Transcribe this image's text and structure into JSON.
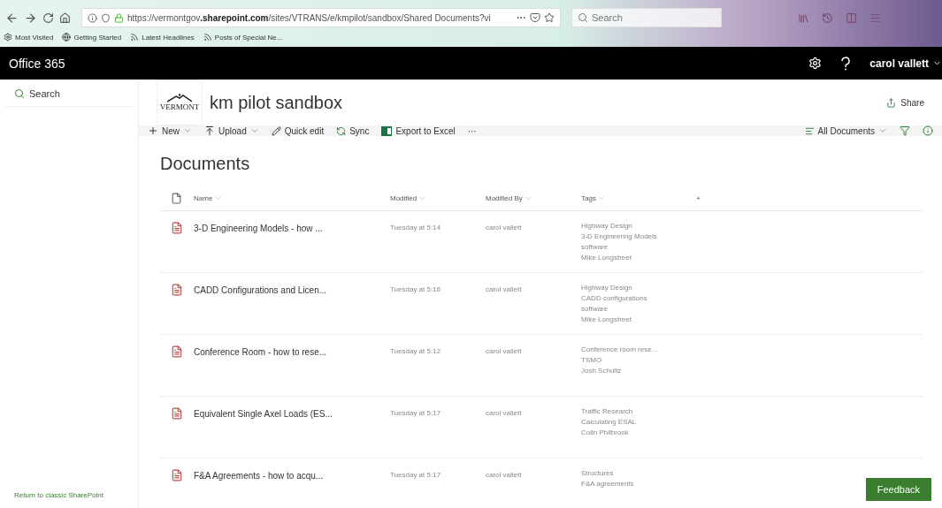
{
  "browser": {
    "url": "https://vermontgov**.sharepoint.com**/sites/VTRANS/e/kmpilot/sandbox/Shared Documents?vi",
    "search_placeholder": "Search",
    "bookmarks": [
      {
        "kind": "gear",
        "label": "Most Visited"
      },
      {
        "kind": "globe",
        "label": "Getting Started"
      },
      {
        "kind": "feed",
        "label": "Latest Headlines"
      },
      {
        "kind": "feed",
        "label": "Posts of Special Ne..."
      }
    ]
  },
  "suite_bar": {
    "title": "Office 365",
    "user": "carol vallett"
  },
  "sidebar": {
    "search": "Search",
    "footer_link": "Return to classic SharePoint"
  },
  "site": {
    "logo_text": "VERMONT",
    "title": "km pilot sandbox",
    "share": "Share"
  },
  "command_bar": {
    "items": [
      {
        "kind": "plus",
        "label": "New",
        "dropdown": true
      },
      {
        "kind": "upload",
        "label": "Upload",
        "dropdown": true
      },
      {
        "kind": "pencil",
        "label": "Quick edit",
        "dropdown": false
      },
      {
        "kind": "sync",
        "label": "Sync",
        "dropdown": false
      },
      {
        "kind": "excel",
        "label": "Export to Excel",
        "dropdown": false
      }
    ],
    "more": "···",
    "view": "All Documents"
  },
  "library": {
    "title": "Documents",
    "columns": [
      "Name",
      "Modified",
      "Modified By",
      "Tags"
    ],
    "add_column": "+",
    "rows": [
      {
        "name": "3-D Engineering Models - how ...",
        "modified": "Tuesday at 5:14",
        "modified_by": "carol vallett",
        "tags": [
          "Highway Design",
          "3-D Engineering Models",
          "software",
          "Mike Longstreet"
        ]
      },
      {
        "name": "CADD Configurations and Licen...",
        "modified": "Tuesday at 5:16",
        "modified_by": "carol vallett",
        "tags": [
          "Highway Design",
          "CADD configurations",
          "software",
          "Mike Longstreet"
        ]
      },
      {
        "name": "Conference Room - how to rese...",
        "modified": "Tuesday at 5:12",
        "modified_by": "carol vallett",
        "tags": [
          "Conference room rese...",
          "TSMO",
          "Josh Schultz"
        ]
      },
      {
        "name": "Equivalent Single Axel Loads (ES...",
        "modified": "Tuesday at 5:17",
        "modified_by": "carol vallett",
        "tags": [
          "Traffic Research",
          "Calculating ESAL",
          "Colin Philbrook"
        ]
      },
      {
        "name": "F&A Agreements - how to acqu...",
        "modified": "Tuesday at 5:17",
        "modified_by": "carol vallett",
        "tags": [
          "Structures",
          "F&A agreements"
        ]
      }
    ]
  },
  "feedback": "Feedback"
}
